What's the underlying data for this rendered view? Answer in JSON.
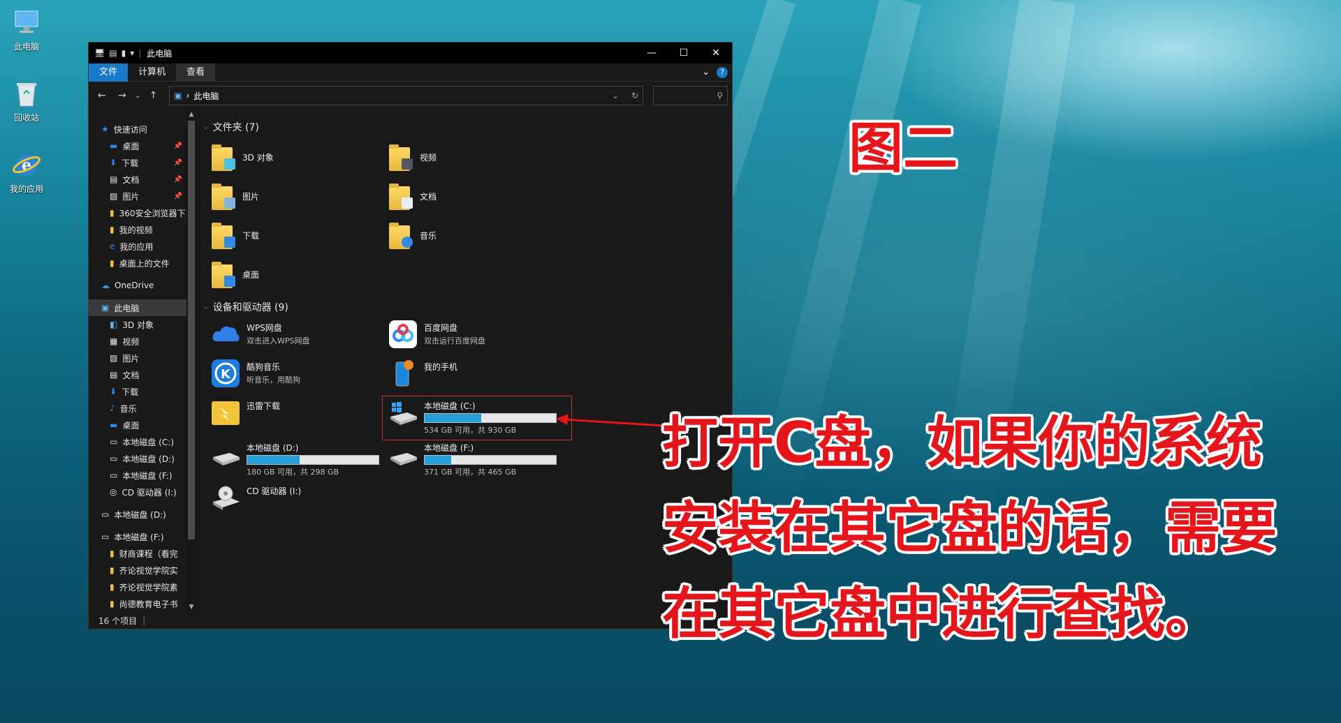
{
  "desktop": {
    "icons": [
      {
        "label": "此电脑",
        "icon": "computer-icon"
      },
      {
        "label": "回收站",
        "icon": "recycle-bin-icon"
      },
      {
        "label": "我的应用",
        "icon": "ie-icon"
      }
    ]
  },
  "window": {
    "title": "此电脑",
    "controls": {
      "minimize": "—",
      "maximize": "☐",
      "close": "✕"
    },
    "ribbon": {
      "tabs": [
        "文件",
        "计算机",
        "查看"
      ]
    },
    "address": {
      "path": "此电脑",
      "separator": "›"
    },
    "nav": {
      "quick_access": "快速访问",
      "quick_items": [
        "桌面",
        "下载",
        "文档",
        "图片",
        "360安全浏览器下",
        "我的视频",
        "我的应用",
        "桌面上的文件"
      ],
      "onedrive": "OneDrive",
      "this_pc": "此电脑",
      "pc_items": [
        "3D 对象",
        "视频",
        "图片",
        "文档",
        "下载",
        "音乐",
        "桌面",
        "本地磁盘 (C:)",
        "本地磁盘 (D:)",
        "本地磁盘 (F:)",
        "CD 驱动器 (I:)"
      ],
      "drive_d": "本地磁盘 (D:)",
      "drive_f": "本地磁盘 (F:)",
      "f_items": [
        "财商课程（看完",
        "齐论视觉学院实",
        "齐论视觉学院素",
        "尚德教育电子书"
      ]
    },
    "folders_header": "文件夹 (7)",
    "folders": [
      "3D 对象",
      "视频",
      "图片",
      "文档",
      "下载",
      "音乐",
      "桌面"
    ],
    "devices_header": "设备和驱动器 (9)",
    "devices": [
      {
        "name": "WPS网盘",
        "sub": "双击进入WPS网盘"
      },
      {
        "name": "百度网盘",
        "sub": "双击运行百度网盘"
      },
      {
        "name": "酷狗音乐",
        "sub": "听音乐，用酷狗"
      },
      {
        "name": "我的手机",
        "sub": ""
      },
      {
        "name": "迅雷下载",
        "sub": ""
      }
    ],
    "drives": [
      {
        "name": "本地磁盘 (C:)",
        "sub": "534 GB 可用，共 930 GB",
        "used_fraction": 0.43
      },
      {
        "name": "本地磁盘 (D:)",
        "sub": "180 GB 可用，共 298 GB",
        "used_fraction": 0.4
      },
      {
        "name": "本地磁盘 (F:)",
        "sub": "371 GB 可用，共 465 GB",
        "used_fraction": 0.2
      },
      {
        "name": "CD 驱动器 (I:)",
        "sub": ""
      }
    ],
    "status": "16 个项目"
  },
  "annotations": {
    "figure_label": "图二",
    "line1": "打开C盘，如果你的系统",
    "line2": "安装在其它盘的话，需要",
    "line3": "在其它盘中进行查找。"
  },
  "colors": {
    "accent": "#1979ca",
    "annotation_red": "#e5151c",
    "drive_bar": "#26a0da"
  }
}
